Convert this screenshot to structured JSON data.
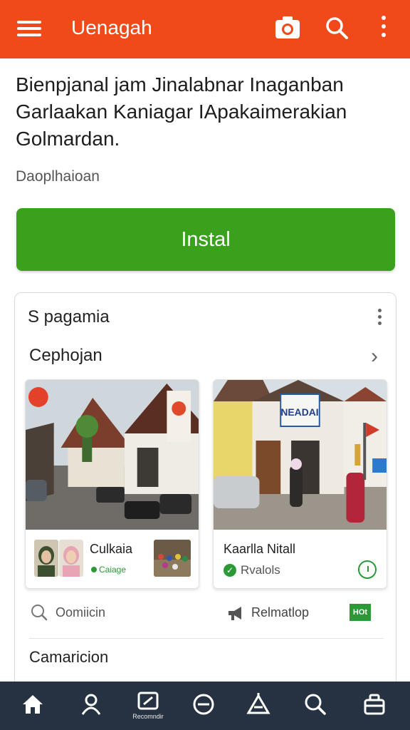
{
  "app_bar": {
    "title": "Uenagah",
    "menu_icon": "hamburger-menu-icon",
    "camera_icon": "camera-icon",
    "search_icon": "search-icon",
    "more_icon": "more-vertical-icon",
    "color": "#f04a1b"
  },
  "headline": {
    "line1": "Bienpjanal jam Jinalabnar Inaganban",
    "line2": "Garlaakan Kaniagar IApakaimerakian",
    "line3": "Golmardan."
  },
  "subtitle": "Daoplhaioan",
  "install_button": {
    "label": "Instal",
    "color": "#3aa11c"
  },
  "section": {
    "title": "S pagamia",
    "subheading": "Cephojan",
    "tiles": [
      {
        "label": "Culkaia",
        "mini_label": "Caiage"
      },
      {
        "label": "Kaarlla Nitall",
        "status": "Rvalols",
        "banner": "NEADAI"
      }
    ],
    "row": {
      "search_text": "Oomiicin",
      "related": "Relmatlop",
      "badge": "HOt"
    },
    "footer_heading": "Camaricion"
  },
  "bottom_nav": {
    "items": [
      "home-icon",
      "profile-icon",
      "edit-icon",
      "compass-icon",
      "tent-icon",
      "search-icon",
      "bag-icon"
    ],
    "center_label": "Recomndir",
    "color": "#263241"
  }
}
